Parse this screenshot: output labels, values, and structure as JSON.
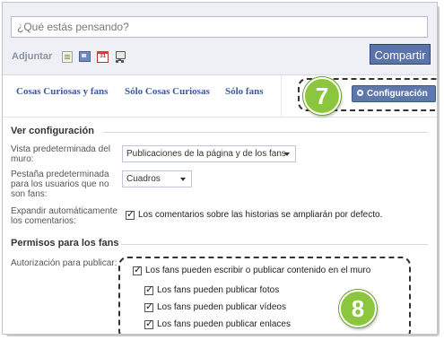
{
  "composer": {
    "placeholder": "¿Qué estás pensando?",
    "attach_label": "Adjuntar",
    "attach_icons": [
      "note-icon",
      "photo-icon",
      "event-icon",
      "link-icon"
    ],
    "event_icon_text": "31",
    "share_label": "Compartir"
  },
  "tabs": [
    "Cosas Curiosas y fans",
    "Sólo Cosas Curiosas",
    "Sólo fans"
  ],
  "config_button_label": "Configuración",
  "callouts": {
    "first": "7",
    "second": "8"
  },
  "view_settings": {
    "title": "Ver configuración",
    "wall_default_label": "Vista predeterminada del muro:",
    "wall_default_value": "Publicaciones de la página y de los fans",
    "tab_default_label": "Pestaña predeterminada para los usuarios que no son fans:",
    "tab_default_value": "Cuadros",
    "expand_comments_label": "Expandir automáticamente los comentarios:",
    "expand_comments_text": "Los comentarios sobre las historias se ampliarán por defecto."
  },
  "permissions": {
    "title": "Permisos para los fans",
    "publish_label": "Autorización para publicar:",
    "main_option": "Los fans pueden escribir o publicar contenido en el muro",
    "sub_options": [
      "Los fans pueden publicar fotos",
      "Los fans pueden publicar vídeos",
      "Los fans pueden publicar enlaces"
    ]
  },
  "colors": {
    "accent": "#3b5998",
    "button": "#5b74a8",
    "badge": "#8cc63f"
  }
}
